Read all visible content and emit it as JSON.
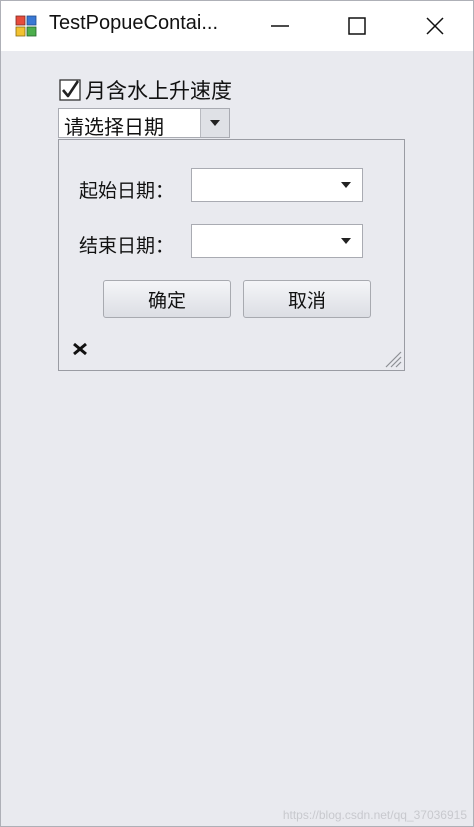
{
  "window": {
    "title": "TestPopueContai...",
    "minimize_icon": "minimize-icon",
    "maximize_icon": "maximize-icon",
    "close_icon": "close-icon"
  },
  "main": {
    "checkbox": {
      "label": "月含水上升速度",
      "checked": true
    },
    "combo": {
      "value": "请选择日期"
    }
  },
  "popup": {
    "start_label": "起始日期：",
    "start_value": "",
    "end_label": "结束日期：",
    "end_value": "",
    "ok_label": "确定",
    "cancel_label": "取消",
    "close_icon": "close-x-icon",
    "resize_icon": "resize-grip-icon"
  },
  "watermark": "https://blog.csdn.net/qq_37036915",
  "colors": {
    "background": "#e9eaef",
    "titlebar": "#ffffff"
  }
}
